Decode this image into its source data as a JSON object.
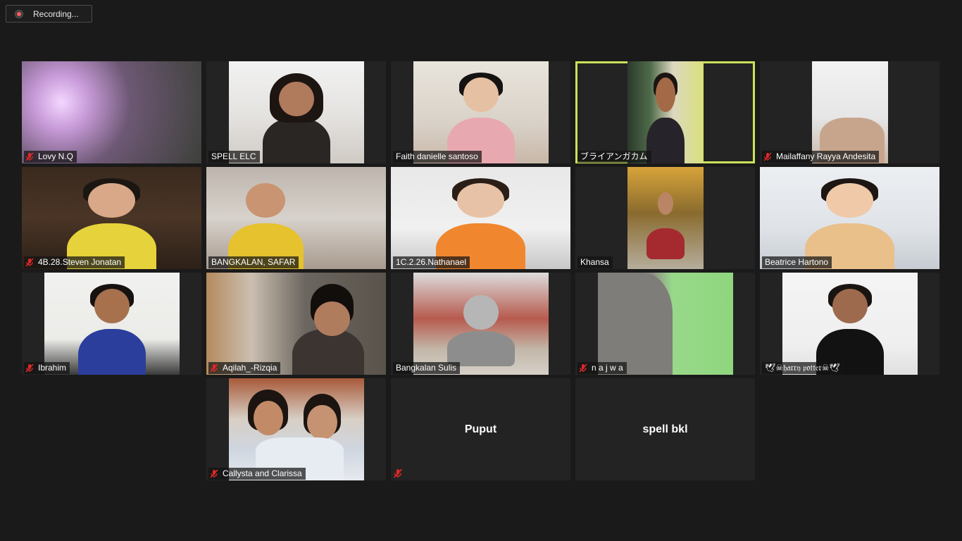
{
  "recording": {
    "label": "Recording..."
  },
  "participants": [
    {
      "name": "Lovy N.Q",
      "muted": true
    },
    {
      "name": "SPELL ELC",
      "muted": false
    },
    {
      "name": "Faith danielle santoso",
      "muted": false
    },
    {
      "name": "ブライアンガカム",
      "muted": false,
      "active_speaker": true
    },
    {
      "name": "Mailaffany Rayya Andesita",
      "muted": true
    },
    {
      "name": "4B.28.Steven Jonatan",
      "muted": true
    },
    {
      "name": "BANGKALAN, SAFAR",
      "muted": false
    },
    {
      "name": "1C.2.26.Nathanael",
      "muted": false
    },
    {
      "name": "Khansa",
      "muted": false
    },
    {
      "name": "Beatrice Hartono",
      "muted": false
    },
    {
      "name": "Ibrahim",
      "muted": true
    },
    {
      "name": "Aqilah_-Rizqia",
      "muted": true
    },
    {
      "name": "Bangkalan Sulis",
      "muted": false
    },
    {
      "name": "n a j w a",
      "muted": true
    },
    {
      "name": "🕊☠𝔥𝔞𝔯𝔯𝔶 𝔭𝔬𝔱𝔱𝔢𝔯☠🕊",
      "muted": false
    },
    {
      "name": "Callysta and Clarissa",
      "muted": true
    },
    {
      "name": "Puput",
      "muted": true,
      "video_off": true
    },
    {
      "name": "spell bkl",
      "muted": false,
      "video_off": true
    }
  ],
  "colors": {
    "background": "#1a1a1a",
    "tile": "#232323",
    "active_border": "#c9e25a",
    "mute_red": "#e02828"
  }
}
